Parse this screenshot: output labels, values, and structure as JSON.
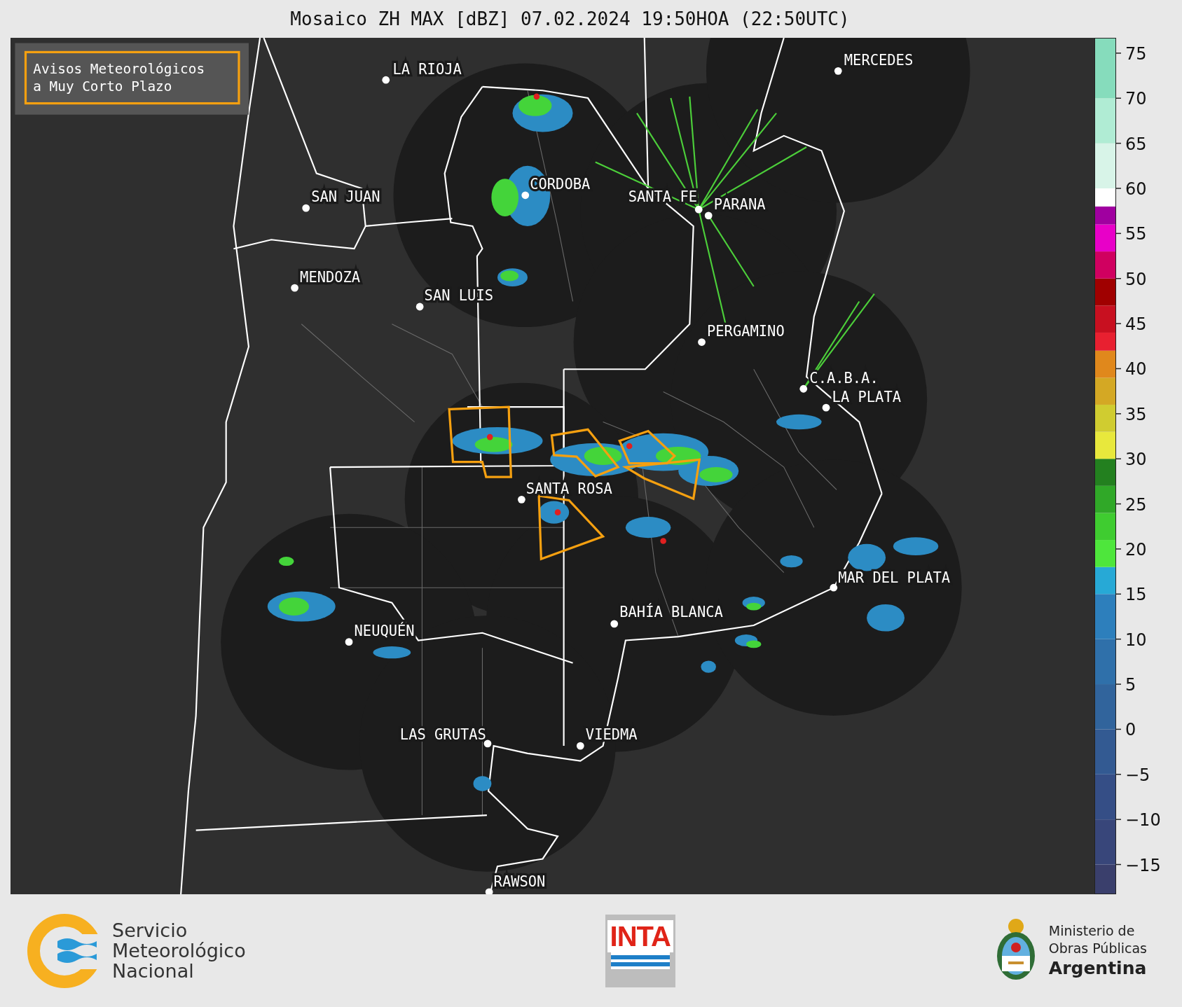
{
  "title": "Mosaico ZH MAX [dBZ] 07.02.2024 19:50HOA (22:50UTC)",
  "map": {
    "legend": {
      "lines": [
        "Avisos Meteorológicos",
        "a Muy Corto Plazo"
      ]
    },
    "cities": [
      "LA RIOJA",
      "CORDOBA",
      "SAN JUAN",
      "SANTA FE",
      "PARANA",
      "MENDOZA",
      "SAN LUIS",
      "MERCEDES",
      "PERGAMINO",
      "C.A.B.A.",
      "LA PLATA",
      "SANTA ROSA",
      "MAR DEL PLATA",
      "BAHÍA BLANCA",
      "NEUQUÉN",
      "LAS GRUTAS",
      "VIEDMA",
      "RAWSON"
    ]
  },
  "colorbar": {
    "ticks": [
      "75",
      "70",
      "65",
      "60",
      "55",
      "50",
      "45",
      "40",
      "35",
      "30",
      "25",
      "20",
      "15",
      "10",
      "5",
      "0",
      "−5",
      "−10",
      "−15"
    ]
  },
  "footer": {
    "smn": {
      "lines": [
        "Servicio",
        "Meteorológico",
        "Nacional"
      ]
    },
    "inta": {
      "text": "INTA"
    },
    "ministry": {
      "lines": [
        "Ministerio de",
        "Obras Públicas",
        "Argentina"
      ]
    }
  }
}
